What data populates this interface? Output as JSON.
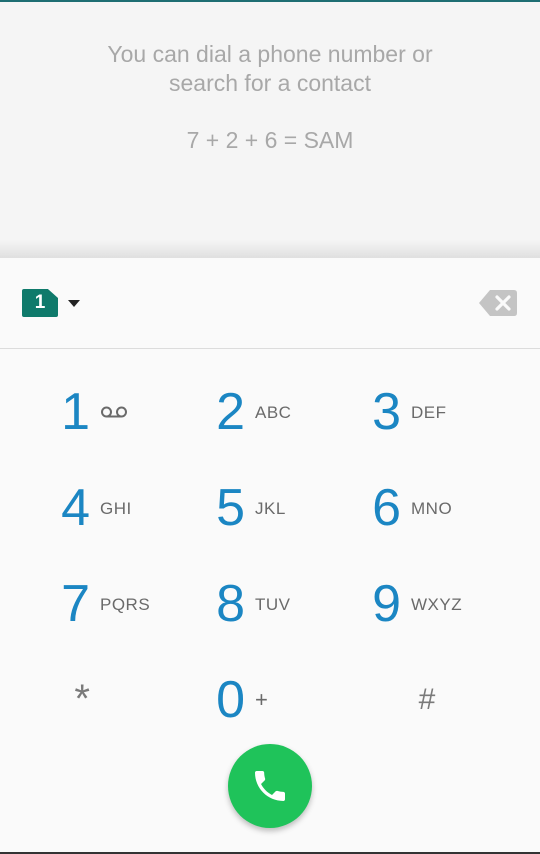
{
  "hint": {
    "message": "You can dial a phone number or search for a contact",
    "example": "7 + 2 + 6 = SAM"
  },
  "sim": {
    "label": "1",
    "color": "#0f7a6b"
  },
  "keys": [
    {
      "digit": "1",
      "letters": "",
      "icon": "voicemail-icon"
    },
    {
      "digit": "2",
      "letters": "ABC"
    },
    {
      "digit": "3",
      "letters": "DEF"
    },
    {
      "digit": "4",
      "letters": "GHI"
    },
    {
      "digit": "5",
      "letters": "JKL"
    },
    {
      "digit": "6",
      "letters": "MNO"
    },
    {
      "digit": "7",
      "letters": "PQRS"
    },
    {
      "digit": "8",
      "letters": "TUV"
    },
    {
      "digit": "9",
      "letters": "WXYZ"
    },
    {
      "digit": "*",
      "letters": ""
    },
    {
      "digit": "0",
      "letters": "+"
    },
    {
      "digit": "#",
      "letters": ""
    }
  ],
  "colors": {
    "digit": "#1b86c3",
    "call_button": "#1fc35a",
    "hint_text": "#a8a8a8"
  },
  "icons": {
    "backspace": "backspace-icon",
    "call": "phone-icon",
    "sim_dropdown": "chevron-down-icon"
  }
}
